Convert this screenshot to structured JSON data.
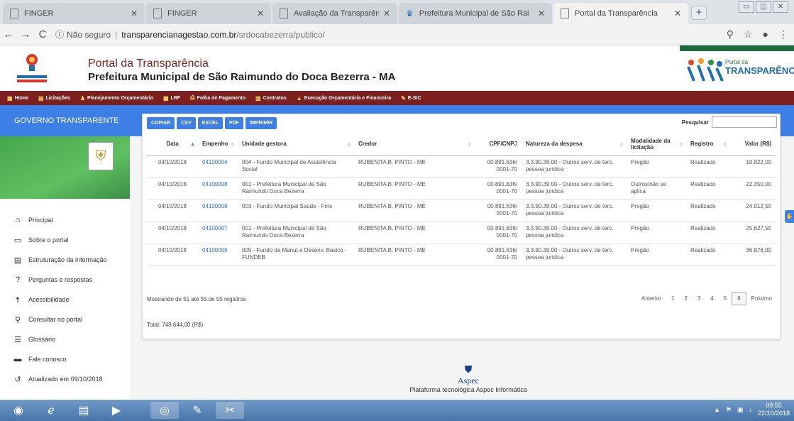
{
  "browser": {
    "tabs": [
      {
        "title": "FINGER",
        "active": false
      },
      {
        "title": "FINGER",
        "active": false
      },
      {
        "title": "Avaliação da Transparência dos",
        "active": false
      },
      {
        "title": "Prefeitura Municipal de São Rai",
        "active": false
      },
      {
        "title": "Portal da Transparência",
        "active": true
      }
    ],
    "security_label": "Não seguro",
    "url_host": "transparencianagestao.com.br",
    "url_path": "/srdocabezerra/publico/"
  },
  "header": {
    "logo_text": "São Raimundo do Doca Bezerra",
    "title": "Portal da Transparência",
    "subtitle": "Prefeitura Municipal de São Raimundo do Doca Bezerra - MA",
    "badge_small": "Portal da",
    "badge_big": "TRANSPARÊNCIA"
  },
  "topmenu": [
    {
      "label": "Home",
      "icon": "home-icon"
    },
    {
      "label": "Licitações",
      "icon": "folder-icon"
    },
    {
      "label": "Planejamento Orçamentário",
      "icon": "person-icon"
    },
    {
      "label": "LRF",
      "icon": "book-icon"
    },
    {
      "label": "Folha de Pagamento",
      "icon": "printer-icon"
    },
    {
      "label": "Contratos",
      "icon": "file-icon"
    },
    {
      "label": "Execução Orçamentária e Financeira",
      "icon": "chart-icon"
    },
    {
      "label": "E-SIC",
      "icon": "edit-icon"
    }
  ],
  "govbar": {
    "title": "GOVERNO TRANSPARENTE"
  },
  "sidebar": {
    "items": [
      {
        "label": "Principal",
        "icon": "home-icon"
      },
      {
        "label": "Sobre o portal",
        "icon": "folder-icon"
      },
      {
        "label": "Estruturação da informação",
        "icon": "layout-icon"
      },
      {
        "label": "Perguntas e respostas",
        "icon": "question-icon"
      },
      {
        "label": "Acessibilidade",
        "icon": "accessibility-icon"
      },
      {
        "label": "Consultar no portal",
        "icon": "search-icon"
      },
      {
        "label": "Glossário",
        "icon": "list-icon"
      },
      {
        "label": "Fale conosco",
        "icon": "message-icon"
      },
      {
        "label": "Atualizado em 09/10/2018",
        "icon": "history-icon"
      }
    ]
  },
  "toolbar": {
    "buttons": [
      "COPIAR",
      "CSV",
      "EXCEL",
      "PDF",
      "IMPRIMIR"
    ],
    "search_label": "Pesquisar"
  },
  "table": {
    "headers": [
      "Data",
      "Empenho",
      "Unidade gestora",
      "Credor",
      "CPF/CNPJ",
      "Natureza da despesa",
      "Modalidade da licitação",
      "Registro",
      "Valor (R$)"
    ],
    "rows": [
      [
        "04/10/2018",
        "04100004",
        "004 - Fundo Municipal de Assistência Social",
        "RUBENITA B. PINTO - ME",
        "00.891.636/ 0001-70",
        "3.3.90.39.00 - Outros serv. de terc. pessoa juridica",
        "Pregão",
        "Realizado",
        "10.822,00"
      ],
      [
        "04/10/2018",
        "04100008",
        "001 - Prefeitura Municipal de São Raimundo Doca Bezerra",
        "RUBENITA B. PINTO - ME",
        "00.891.636/ 0001-70",
        "3.3.90.39.00 - Outros serv. de terc. pessoa juridica",
        "Outros/não se aplica",
        "Realizado",
        "22.350,00"
      ],
      [
        "04/10/2018",
        "04100009",
        "003 - Fundo Municipal Saúde - Fms",
        "RUBENITA B. PINTO - ME",
        "00.891.636/ 0001-70",
        "3.3.90.39.00 - Outros serv. de terc. pessoa juridica",
        "Pregão",
        "Realizado",
        "24.012,50"
      ],
      [
        "04/10/2018",
        "04100007",
        "001 - Prefeitura Municipal de São Raimundo Doca Bezerra",
        "RUBENITA B. PINTO - ME",
        "00.891.636/ 0001-70",
        "3.3.90.39.00 - Outros serv. de terc. pessoa juridica",
        "Pregão",
        "Realizado",
        "25.627,50"
      ],
      [
        "04/10/2018",
        "04100006",
        "005 - Fundo de Manut.e Desenv. Basico - FUNDEB",
        "RUBENITA B. PINTO - ME",
        "00.891.636/ 0001-70",
        "3.3.90.39.00 - Outros serv. de terc. pessoa juridica",
        "Pregão",
        "Realizado",
        "36.876,00"
      ]
    ]
  },
  "info": "Mostrando de 51 até 55 de 55 registros",
  "total": "Total: 748.644,00 (R$)",
  "pager": {
    "prev": "Anterior",
    "pages": [
      "1",
      "2",
      "3",
      "4",
      "5",
      "6"
    ],
    "current": "6",
    "next": "Próximo"
  },
  "footer": {
    "brand": "Aspec",
    "text": "Plataforma tecnológica Aspec Informática"
  },
  "taskbar": {
    "time": "09:55",
    "date": "22/10/2018"
  }
}
